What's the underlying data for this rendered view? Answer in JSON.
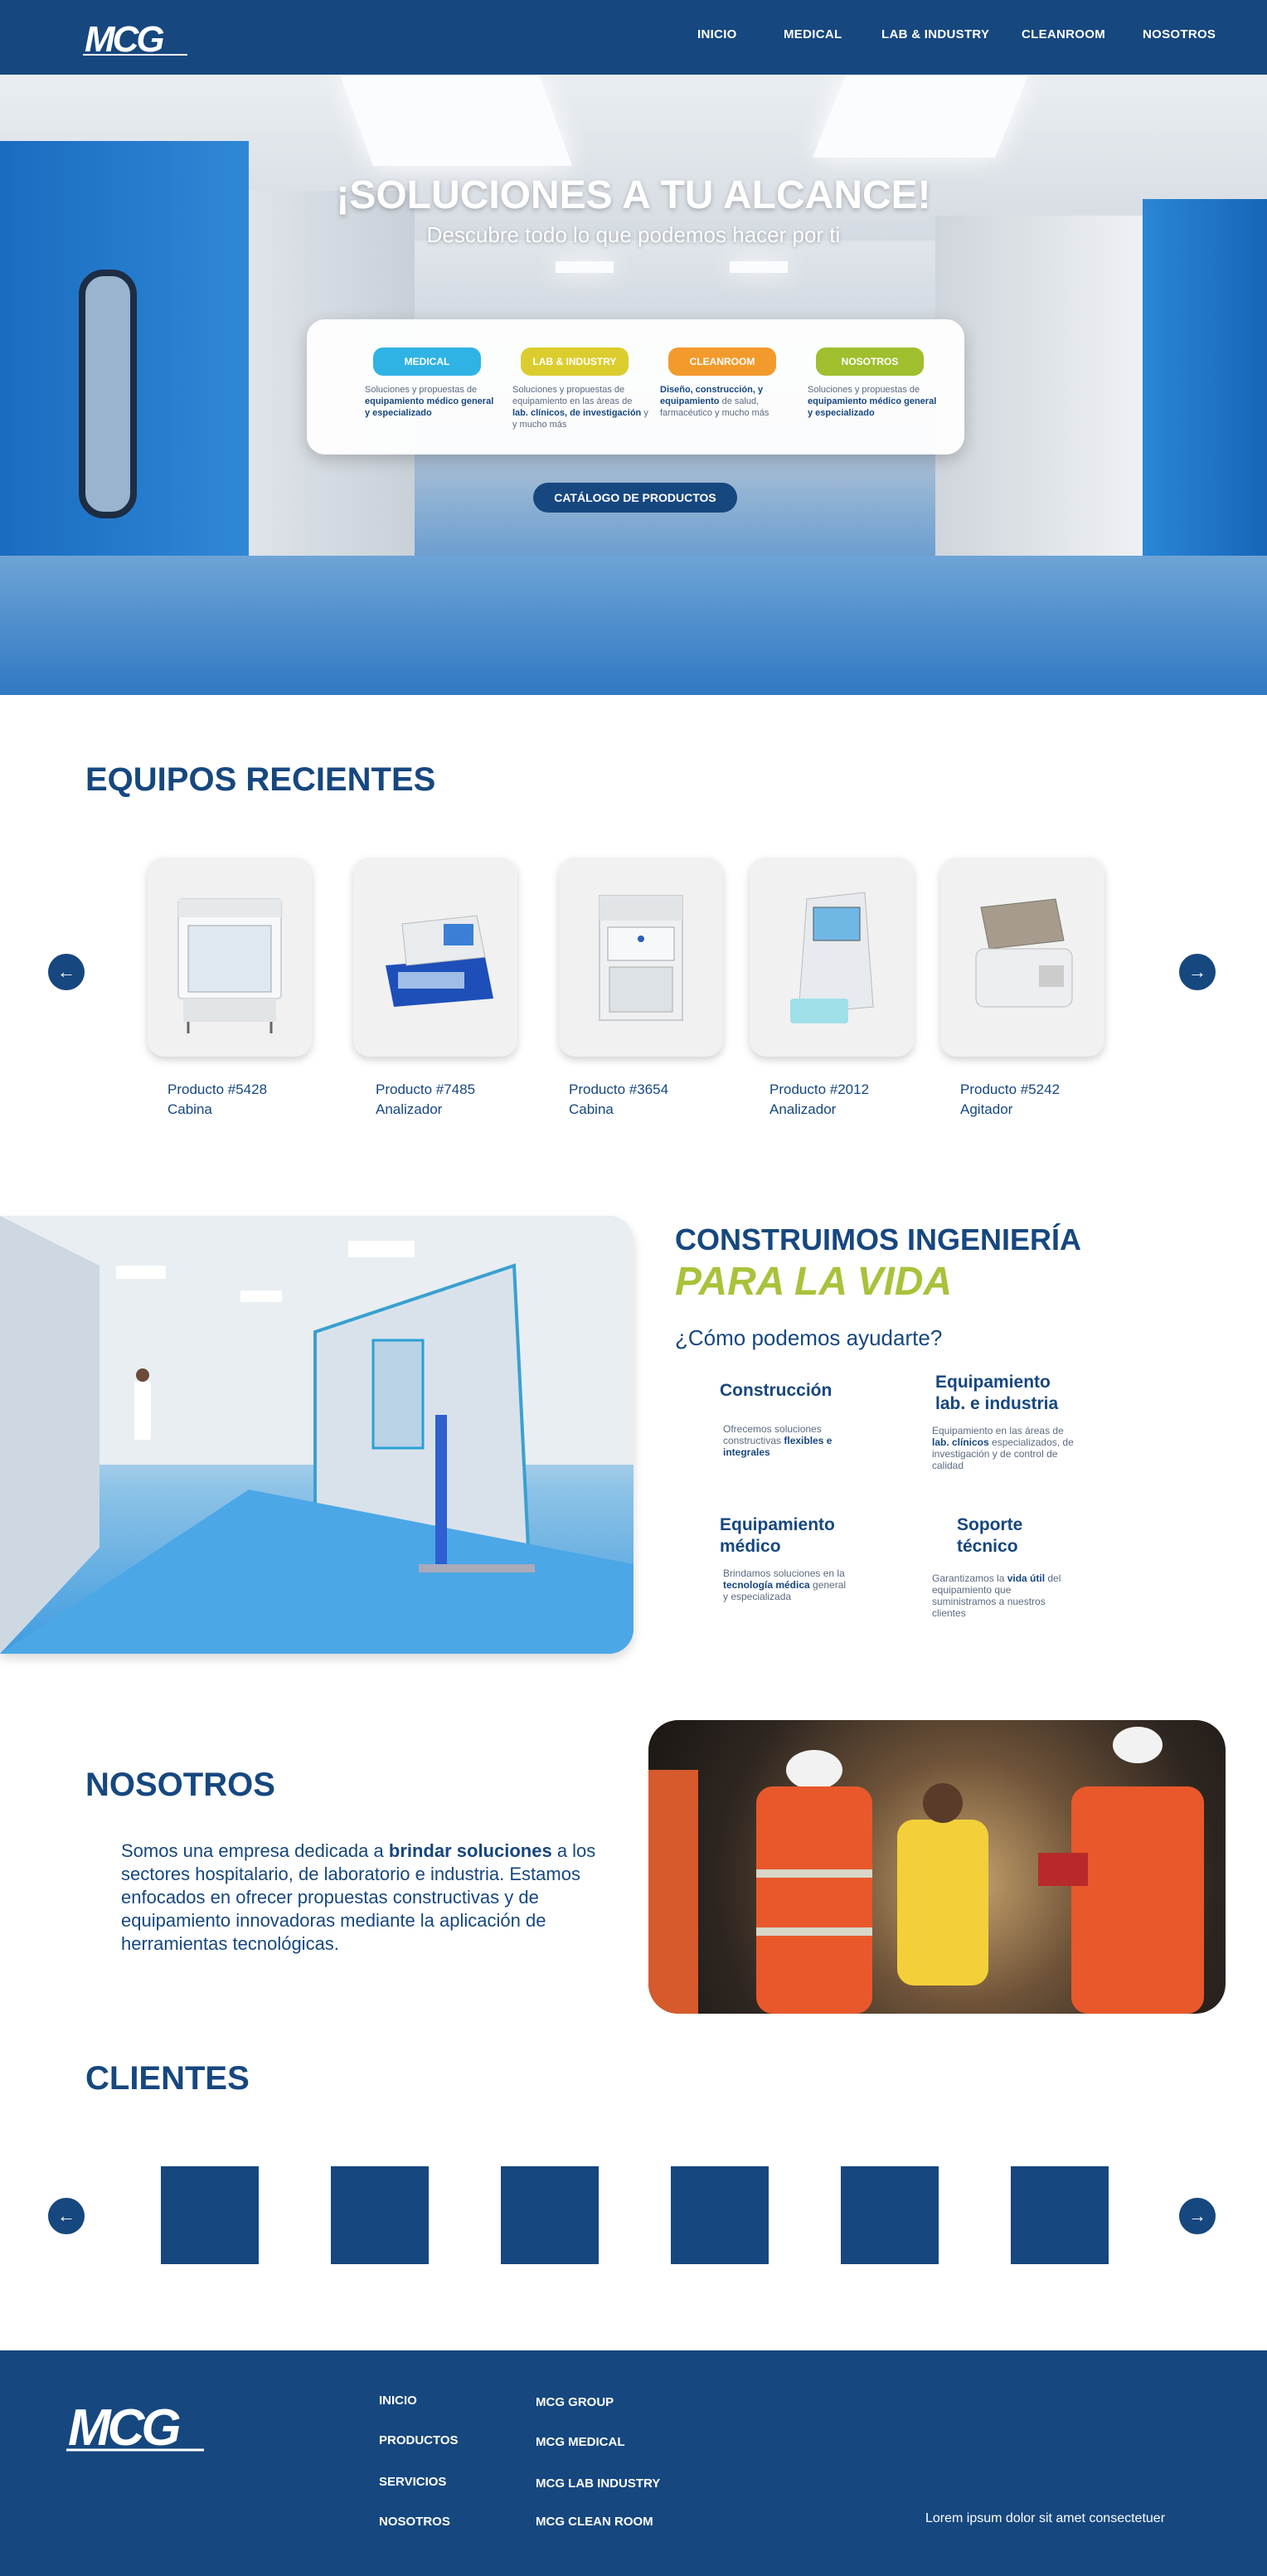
{
  "nav": {
    "logo_text": "MCG",
    "items": [
      "INICIO",
      "MEDICAL",
      "LAB & INDUSTRY",
      "CLEANROOM",
      "NOSOTROS"
    ]
  },
  "hero": {
    "title": "¡SOLUCIONES A TU ALCANCE!",
    "subtitle": "Descubre todo lo que podemos hacer por ti",
    "categories": [
      {
        "label": "MEDICAL",
        "color": "#2fb3e4",
        "desc_pre": "Soluciones y propuestas de ",
        "desc_bold": "equipamiento médico general y especializado",
        "desc_post": ""
      },
      {
        "label": "LAB & INDUSTRY",
        "color": "#dccd2f",
        "desc_pre": "Soluciones y propuestas de equipamiento en las áreas de ",
        "desc_bold": "lab. clínicos, de investigación",
        "desc_post": " y y mucho más"
      },
      {
        "label": "CLEANROOM",
        "color": "#f39a2c",
        "desc_pre": "",
        "desc_bold": "Diseño, construcción, y equipamiento",
        "desc_post": " de salud, farmacéutico y mucho más"
      },
      {
        "label": "NOSOTROS",
        "color": "#9fbf2e",
        "desc_pre": "Soluciones y propuestas de ",
        "desc_bold": "equipamiento médico general y especializado",
        "desc_post": ""
      }
    ],
    "catalog_button": "CATÁLOGO DE PRODUCTOS"
  },
  "recent": {
    "title": "EQUIPOS RECIENTES",
    "products": [
      {
        "label": "Producto #5428\nCabina",
        "icon": "biosafety-cabinet"
      },
      {
        "label": "Producto #7485\nAnalizador",
        "icon": "elisa-washer"
      },
      {
        "label": "Producto #3654\nCabina",
        "icon": "cabinet"
      },
      {
        "label": "Producto #2012\nAnalizador",
        "icon": "analyzer"
      },
      {
        "label": "Producto #5242\nAgitador",
        "icon": "shaker"
      }
    ]
  },
  "build": {
    "title_line1": "CONSTRUIMOS INGENIERÍA",
    "title_line2": "PARA LA VIDA",
    "question": "¿Cómo podemos ayudarte?",
    "services": [
      {
        "title": "Construcción",
        "desc_pre": "Ofrecemos soluciones constructivas ",
        "desc_bold": "flexibles e integrales",
        "desc_post": ""
      },
      {
        "title": "Equipamiento\nlab. e industria",
        "desc_pre": "Equipamiento en las áreas de ",
        "desc_bold": "lab. clínicos",
        "desc_post": " especializados, de investigación y de control de calidad"
      },
      {
        "title": "Equipamiento\nmédico",
        "desc_pre": "Brindamos soluciones en la ",
        "desc_bold": "tecnología médica",
        "desc_post": " general y especializada"
      },
      {
        "title": "Soporte\ntécnico",
        "desc_pre": "Garantizamos la ",
        "desc_bold": "vida útil",
        "desc_post": " del equipamiento que suministramos a nuestros clientes"
      }
    ]
  },
  "about": {
    "title": "NOSOTROS",
    "text_pre": "Somos una empresa dedicada a ",
    "text_bold": "brindar soluciones",
    "text_post": " a los sectores hospitalario, de laboratorio e industria. Estamos enfocados en ofrecer propuestas constructivas y de equipamiento innovadoras  mediante la aplicación de herramientas tecnológicas."
  },
  "clients": {
    "title": "CLIENTES",
    "count": 6
  },
  "footer": {
    "logo_text": "MCG",
    "col1": [
      "INICIO",
      "PRODUCTOS",
      "SERVICIOS",
      "NOSOTROS"
    ],
    "col2": [
      "MCG GROUP",
      "MCG MEDICAL",
      "MCG LAB INDUSTRY",
      "MCG CLEAN ROOM"
    ],
    "text": "Lorem ipsum dolor sit amet consectetuer"
  }
}
